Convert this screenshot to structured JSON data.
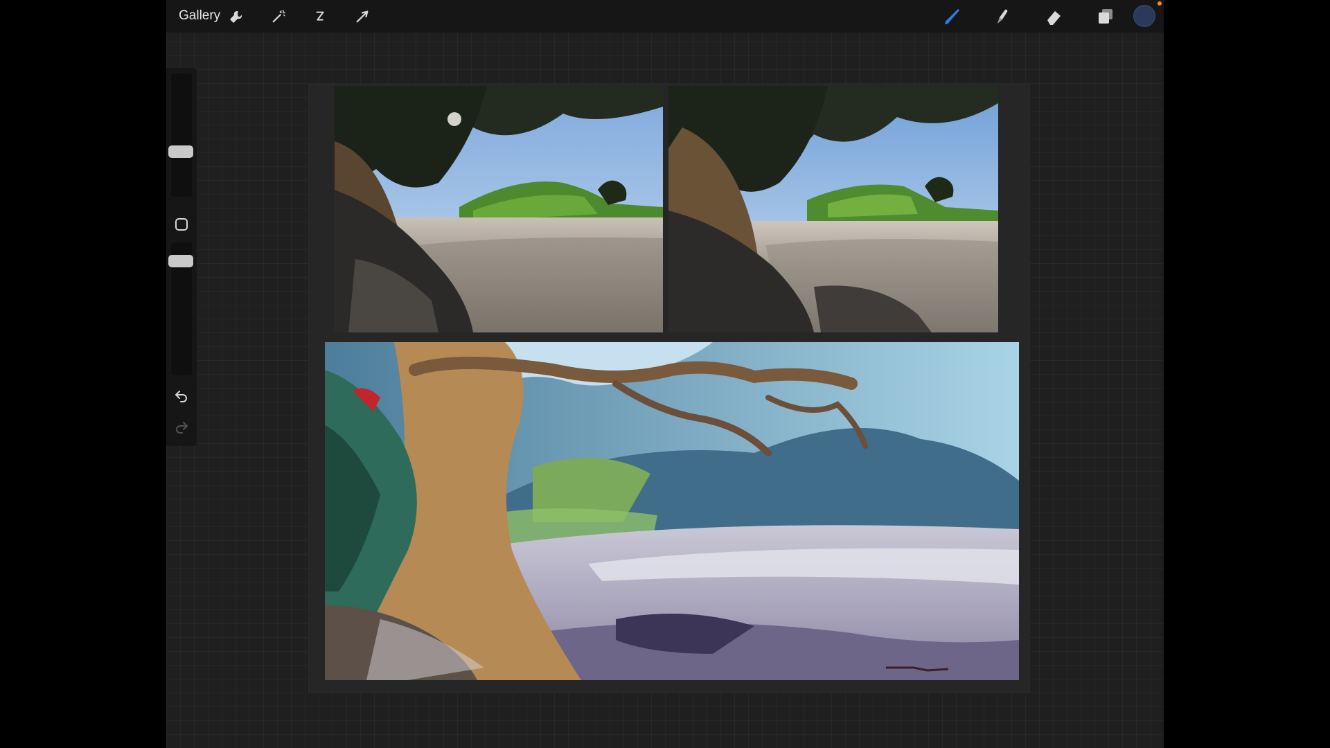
{
  "toolbar": {
    "gallery_label": "Gallery",
    "left_tools": [
      {
        "icon": "wrench-icon",
        "name": "actions"
      },
      {
        "icon": "magic-wand-icon",
        "name": "adjustments"
      },
      {
        "icon": "selection-icon",
        "name": "selection"
      },
      {
        "icon": "arrow-cursor-icon",
        "name": "transform"
      }
    ],
    "right_tools": [
      {
        "icon": "brush-icon",
        "name": "brush",
        "active": true,
        "color": "#2f7fe6"
      },
      {
        "icon": "smudge-icon",
        "name": "smudge"
      },
      {
        "icon": "eraser-icon",
        "name": "eraser"
      },
      {
        "icon": "layers-icon",
        "name": "layers"
      }
    ],
    "current_color": "#2b3a5c",
    "notification_color": "#ff8a1f"
  },
  "sidebar": {
    "brush_size_icon": "slider-thumb",
    "modify_icon": "square-outline-icon",
    "opacity_icon": "slider-thumb",
    "undo_icon": "undo-arrow-icon",
    "redo_icon": "redo-arrow-icon"
  },
  "canvas": {
    "images": [
      {
        "name": "reference-photo-left",
        "subject": "photo"
      },
      {
        "name": "reference-photo-right",
        "subject": "photo"
      },
      {
        "name": "gouache-painting",
        "subject": "painting"
      }
    ]
  }
}
